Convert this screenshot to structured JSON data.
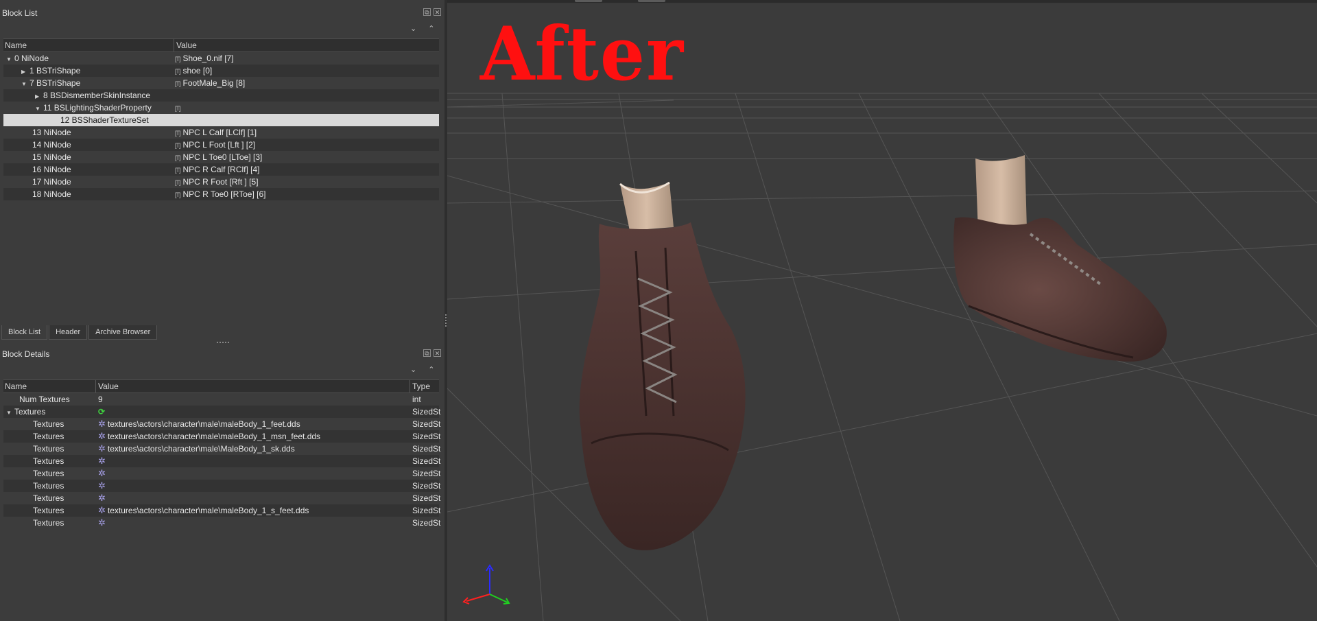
{
  "block_list": {
    "title": "Block List",
    "columns": [
      "Name",
      "Value"
    ],
    "rows": [
      {
        "name": "0 NiNode",
        "value": "Shoe_0.nif [7]"
      },
      {
        "name": "1 BSTriShape",
        "value": "shoe [0]"
      },
      {
        "name": "7 BSTriShape",
        "value": "FootMale_Big [8]"
      },
      {
        "name": "8 BSDismemberSkinInstance",
        "value": ""
      },
      {
        "name": "11 BSLightingShaderProperty",
        "value": ""
      },
      {
        "name": "12 BSShaderTextureSet",
        "value": ""
      },
      {
        "name": "13 NiNode",
        "value": "NPC L Calf [LClf] [1]"
      },
      {
        "name": "14 NiNode",
        "value": "NPC L Foot [Lft ] [2]"
      },
      {
        "name": "15 NiNode",
        "value": "NPC L Toe0 [LToe] [3]"
      },
      {
        "name": "16 NiNode",
        "value": "NPC R Calf [RClf] [4]"
      },
      {
        "name": "17 NiNode",
        "value": "NPC R Foot [Rft ] [5]"
      },
      {
        "name": "18 NiNode",
        "value": "NPC R Toe0 [RToe] [6]"
      }
    ]
  },
  "tabs": [
    "Block List",
    "Header",
    "Archive Browser"
  ],
  "block_details": {
    "title": "Block Details",
    "columns": [
      "Name",
      "Value",
      "Type"
    ],
    "rows": [
      {
        "name": "Num Textures",
        "value": "9",
        "type": "int"
      },
      {
        "name": "Textures",
        "value": "",
        "type": "SizedSt"
      },
      {
        "name": "Textures",
        "value": "textures\\actors\\character\\male\\maleBody_1_feet.dds",
        "type": "SizedSt"
      },
      {
        "name": "Textures",
        "value": "textures\\actors\\character\\male\\maleBody_1_msn_feet.dds",
        "type": "SizedSt"
      },
      {
        "name": "Textures",
        "value": "textures\\actors\\character\\male\\MaleBody_1_sk.dds",
        "type": "SizedSt"
      },
      {
        "name": "Textures",
        "value": "",
        "type": "SizedSt"
      },
      {
        "name": "Textures",
        "value": "",
        "type": "SizedSt"
      },
      {
        "name": "Textures",
        "value": "",
        "type": "SizedSt"
      },
      {
        "name": "Textures",
        "value": "",
        "type": "SizedSt"
      },
      {
        "name": "Textures",
        "value": "textures\\actors\\character\\male\\maleBody_1_s_feet.dds",
        "type": "SizedSt"
      },
      {
        "name": "Textures",
        "value": "",
        "type": "SizedSt"
      }
    ]
  },
  "viewport": {
    "overlay_text": "After"
  },
  "colors": {
    "accent_red": "#ff1010",
    "selection": "#d9d9d9",
    "background": "#3b3b3b"
  }
}
